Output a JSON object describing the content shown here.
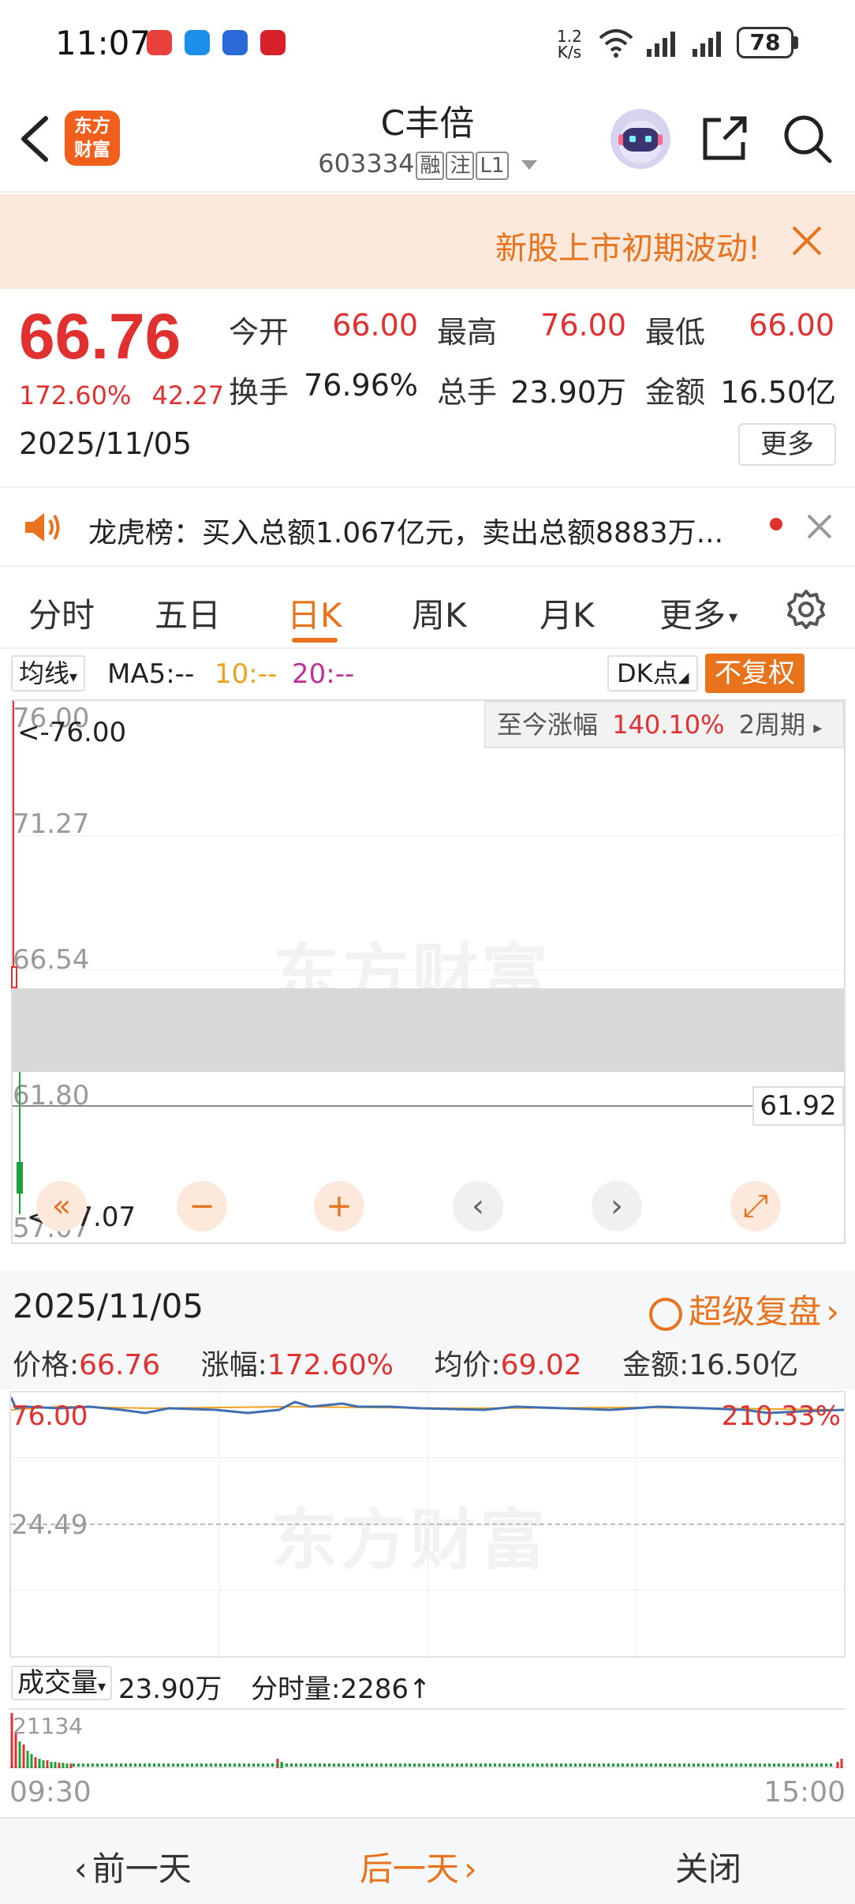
{
  "status_bar": {
    "time": "11:07",
    "net_speed_value": "1.2",
    "net_speed_unit": "K/s",
    "battery": "78"
  },
  "header": {
    "logo_line1": "东方",
    "logo_line2": "财富",
    "stock_name": "C丰倍",
    "stock_code": "603334",
    "tags": [
      "融",
      "注",
      "L1"
    ]
  },
  "banner": {
    "text": "新股上市初期波动!"
  },
  "quote": {
    "price": "66.76",
    "change_pct": "172.60%",
    "change_amt": "42.27",
    "date": "2025/11/05",
    "stats": [
      {
        "label": "今开",
        "value": "66.00"
      },
      {
        "label": "最高",
        "value": "76.00"
      },
      {
        "label": "最低",
        "value": "66.00"
      },
      {
        "label": "换手",
        "value": "76.96%"
      },
      {
        "label": "总手",
        "value": "23.90万"
      },
      {
        "label": "金额",
        "value": "16.50亿"
      }
    ],
    "more_label": "更多"
  },
  "lhb": {
    "text": "龙虎榜：买入总额1.067亿元，卖出总额8883万..."
  },
  "tabs": [
    "分时",
    "五日",
    "日K",
    "周K",
    "月K",
    "更多"
  ],
  "kline": {
    "ma_select": "均线",
    "ma5": "MA5:--",
    "ma10": "10:--",
    "ma20": "20:--",
    "dk_label": "DK点",
    "fuquan_label": "不复权",
    "y_labels": [
      "76.00",
      "71.27",
      "66.54",
      "61.80",
      "57.07"
    ],
    "max_label": "<-76.00",
    "min_label": "<-57.07",
    "period_label": "至今涨幅",
    "period_value": "140.10%",
    "period_unit": "2周期",
    "current_price": "61.92",
    "watermark": "东方财富"
  },
  "detail": {
    "date": "2025/11/05",
    "super_label": "超级复盘",
    "price_label": "价格:",
    "price_value": "66.76",
    "pct_label": "涨幅:",
    "pct_value": "172.60%",
    "avg_label": "均价:",
    "avg_value": "69.02",
    "amount_label": "金额:",
    "amount_value": "16.50亿"
  },
  "intraday": {
    "open_label": "76.00",
    "pct_label": "210.33%",
    "mid_label": "24.49",
    "watermark": "东方财富"
  },
  "volume": {
    "select": "成交量",
    "total": "23.90万",
    "tick_label": "分时量:2286↑",
    "max": "21134",
    "time_start": "09:30",
    "time_end": "15:00"
  },
  "bottom": {
    "prev": "前一天",
    "next": "后一天",
    "close": "关闭"
  },
  "colors": {
    "up_red": "#e03030",
    "accent_orange": "#e8731c",
    "down_green": "#1aa33a"
  }
}
